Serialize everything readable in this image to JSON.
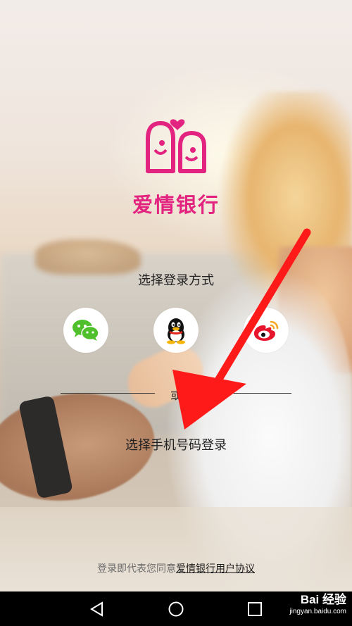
{
  "app": {
    "name": "爱情银行",
    "brand_color": "#e2237f"
  },
  "login": {
    "choose_method": "选择登录方式",
    "methods": [
      {
        "id": "wechat",
        "icon": "wechat-icon",
        "color": "#4fc02c"
      },
      {
        "id": "qq",
        "icon": "qq-penguin-icon",
        "color": "#111111"
      },
      {
        "id": "weibo",
        "icon": "weibo-icon",
        "color": "#e6162d"
      }
    ],
    "or_label": "或",
    "phone_login": "选择手机号码登录"
  },
  "agreement": {
    "prefix": "登录即代表您同意",
    "link": "爱情银行用户协议"
  },
  "annotation": {
    "arrow_color": "#ff1a1a"
  },
  "navbar": {
    "back_icon": "back-triangle-icon",
    "home_icon": "home-circle-icon",
    "recent_icon": "recent-square-icon"
  },
  "watermark": {
    "line1": "Bai 经验",
    "line2": "jingyan.baidu.com"
  }
}
